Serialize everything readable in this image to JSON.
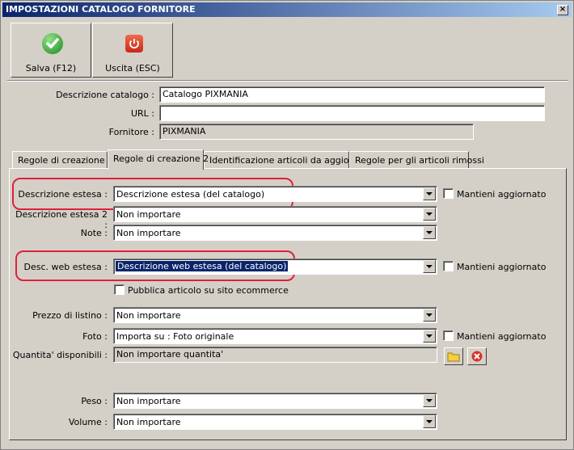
{
  "window": {
    "title": "IMPOSTAZIONI CATALOGO FORNITORE",
    "close": "×"
  },
  "toolbar": {
    "save_label": "Salva (F12)",
    "exit_label": "Uscita (ESC)"
  },
  "header": {
    "descrizione_label": "Descrizione catalogo :",
    "descrizione_value": "Catalogo PIXMANIA",
    "url_label": "URL :",
    "url_value": "",
    "fornitore_label": "Fornitore :",
    "fornitore_value": "PIXMANIA"
  },
  "tabs": [
    "Regole di creazione 1",
    "Regole di creazione 2",
    "Identificazione articoli da aggiornare",
    "Regole per gli articoli rimossi"
  ],
  "form": {
    "desc_estesa_label": "Descrizione estesa :",
    "desc_estesa_value": "Descrizione estesa (del catalogo)",
    "desc_estesa2_label": "Descrizione estesa 2 :",
    "desc_estesa2_value": "Non importare",
    "note_label": "Note :",
    "note_value": "Non importare",
    "web_label": "Desc. web estesa :",
    "web_value": "Descrizione web estesa (del catalogo)",
    "pubblica_label": "Pubblica articolo su sito ecommerce",
    "prezzo_label": "Prezzo di listino :",
    "prezzo_value": "Non importare",
    "foto_label": "Foto :",
    "foto_value": "Importa su : Foto originale",
    "quantita_label": "Quantita' disponibili :",
    "quantita_value": "Non importare quantita'",
    "peso_label": "Peso :",
    "peso_value": "Non importare",
    "volume_label": "Volume :",
    "volume_value": "Non importare",
    "mantieni_label": "Mantieni aggiornato"
  }
}
